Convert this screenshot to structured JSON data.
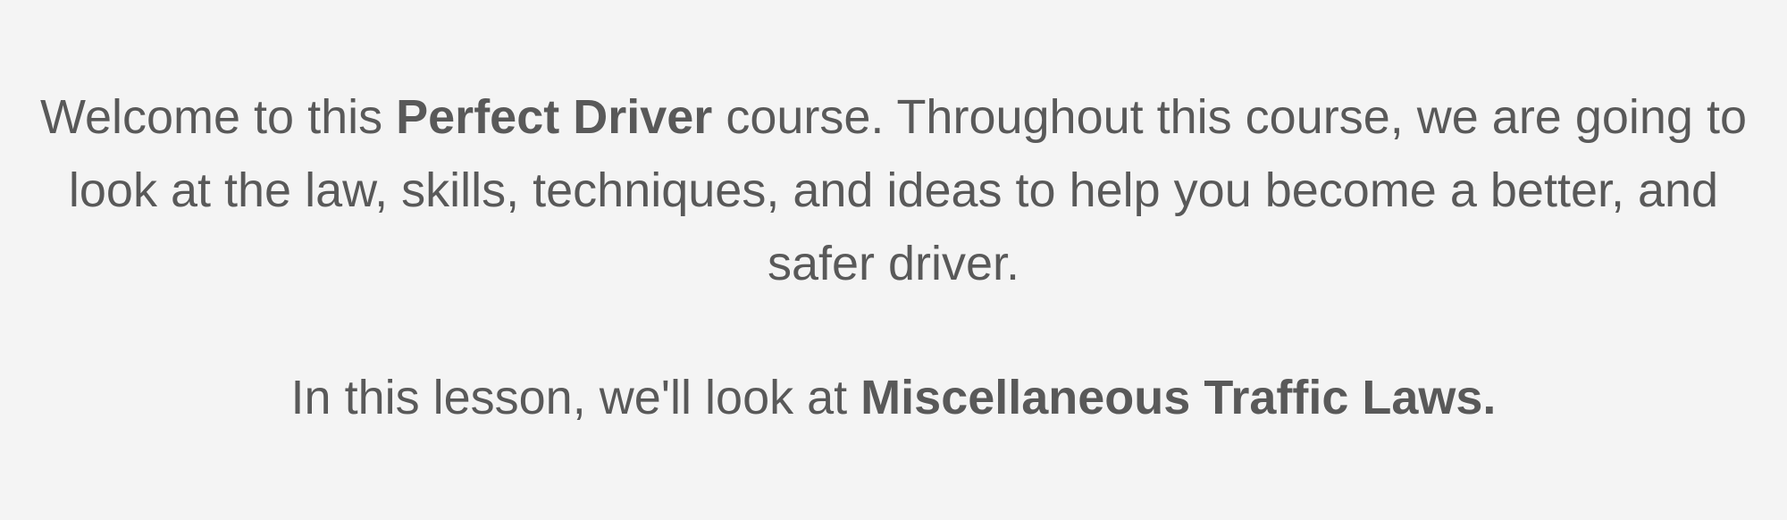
{
  "intro": {
    "part1": "Welcome to this ",
    "course_name": "Perfect Driver",
    "part2": " course. Throughout this course, we are going to look at the law, skills, techniques, and ideas to help you become a better, and safer driver."
  },
  "lesson": {
    "prefix": "In this lesson, we'll look at ",
    "topic": "Miscellaneous Traffic Laws."
  },
  "colors": {
    "background": "#f4f4f4",
    "text": "#595959"
  }
}
